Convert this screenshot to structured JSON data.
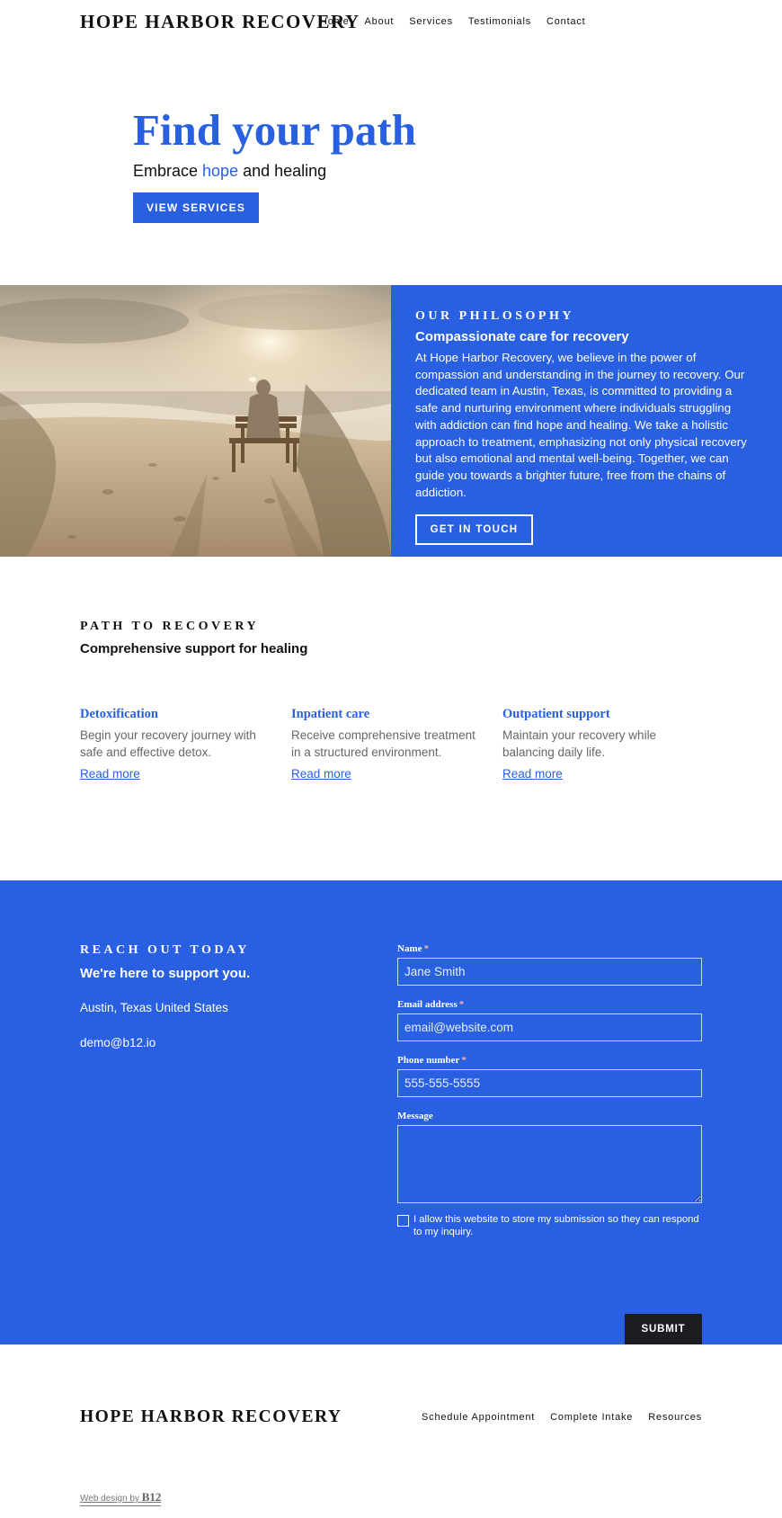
{
  "header": {
    "brand": "HOPE HARBOR RECOVERY",
    "nav": [
      "Home",
      "About",
      "Services",
      "Testimonials",
      "Contact"
    ]
  },
  "hero": {
    "title": "Find your path",
    "subtitle_before": "Embrace ",
    "subtitle_highlight": "hope",
    "subtitle_after": " and healing",
    "cta_label": "VIEW SERVICES"
  },
  "philosophy": {
    "image_description": "Person sitting on a bench on a sandy beach at sunset",
    "eyebrow": "OUR PHILOSOPHY",
    "heading": "Compassionate care for recovery",
    "body": "At Hope Harbor Recovery, we believe in the power of compassion and understanding in the journey to recovery. Our dedicated team in Austin, Texas, is committed to providing a safe and nurturing environment where individuals struggling with addiction can find hope and healing. We take a holistic approach to treatment, emphasizing not only physical recovery but also emotional and mental well-being. Together, we can guide you towards a brighter future, free from the chains of addiction.",
    "cta_label": "GET IN TOUCH"
  },
  "path": {
    "eyebrow": "PATH TO RECOVERY",
    "heading": "Comprehensive support for healing",
    "services": [
      {
        "title": "Detoxification",
        "description": "Begin your recovery journey with safe and effective detox.",
        "link": "Read more"
      },
      {
        "title": "Inpatient care",
        "description": "Receive comprehensive treatment in a structured environment.",
        "link": "Read more"
      },
      {
        "title": "Outpatient support",
        "description": "Maintain your recovery while balancing daily life.",
        "link": "Read more"
      }
    ]
  },
  "contact": {
    "eyebrow": "REACH OUT TODAY",
    "heading": "We're here to support you.",
    "address": "Austin, Texas United States",
    "email": "demo@b12.io",
    "form": {
      "name_label": "Name",
      "name_placeholder": "Jane Smith",
      "email_label": "Email address",
      "email_placeholder": "email@website.com",
      "phone_label": "Phone number",
      "phone_placeholder": "555-555-5555",
      "message_label": "Message",
      "message_value": "",
      "required_marker": "*",
      "consent_text": "I allow this website to store my submission so they can respond to my inquiry.",
      "consent_checked": false,
      "submit_label": "SUBMIT"
    }
  },
  "footer": {
    "brand": "HOPE HARBOR RECOVERY",
    "links": [
      "Schedule Appointment",
      "Complete Intake",
      "Resources"
    ],
    "credit_prefix": "Web design by",
    "credit_brand": "B12"
  },
  "colors": {
    "accent": "#2860e1",
    "submit_bg": "#1c1d22",
    "text": "#111111",
    "muted": "#666666"
  }
}
